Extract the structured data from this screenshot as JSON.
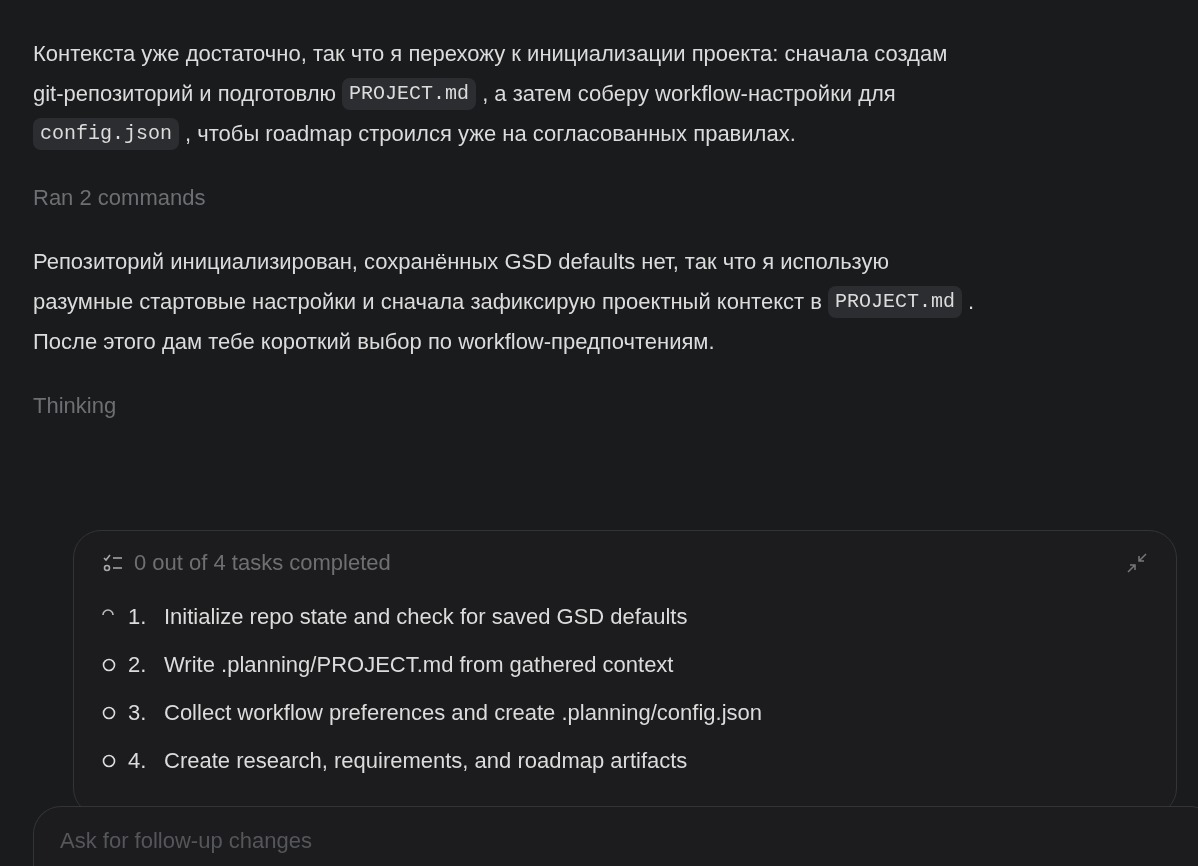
{
  "messages": [
    {
      "kind": "paragraph",
      "lines": [
        [
          {
            "kind": "text",
            "text": "Контекста уже достаточно, так что я перехожу к инициализации проекта: сначала создам"
          }
        ],
        [
          {
            "kind": "text",
            "text": "git-репозиторий и подготовлю"
          },
          {
            "kind": "code",
            "text": "PROJECT.md"
          },
          {
            "kind": "text",
            "text": ", а затем соберу workflow-настройки для"
          }
        ],
        [
          {
            "kind": "code",
            "text": "config.json"
          },
          {
            "kind": "text",
            "text": ", чтобы roadmap строился уже на согласованных правилах."
          }
        ]
      ]
    },
    {
      "kind": "status",
      "text": "Ran 2 commands"
    },
    {
      "kind": "paragraph",
      "lines": [
        [
          {
            "kind": "text",
            "text": "Репозиторий инициализирован, сохранённых GSD defaults нет, так что я использую"
          }
        ],
        [
          {
            "kind": "text",
            "text": "разумные стартовые настройки и сначала зафиксирую проектный контекст в"
          },
          {
            "kind": "code",
            "text": "PROJECT.md"
          },
          {
            "kind": "text",
            "text": "."
          }
        ],
        [
          {
            "kind": "text",
            "text": "После этого дам тебе короткий выбор по workflow-предпочтениям."
          }
        ]
      ]
    },
    {
      "kind": "status",
      "text": "Thinking"
    }
  ],
  "tasks": {
    "summary": "0 out of 4 tasks completed",
    "items": [
      {
        "number": "1.",
        "text": "Initialize repo state and check for saved GSD defaults",
        "in_progress": true
      },
      {
        "number": "2.",
        "text": "Write .planning/PROJECT.md from gathered context",
        "in_progress": false
      },
      {
        "number": "3.",
        "text": "Collect workflow preferences and create .planning/config.json",
        "in_progress": false
      },
      {
        "number": "4.",
        "text": "Create research, requirements, and roadmap artifacts",
        "in_progress": false
      }
    ]
  },
  "composer": {
    "placeholder": "Ask for follow-up changes"
  }
}
